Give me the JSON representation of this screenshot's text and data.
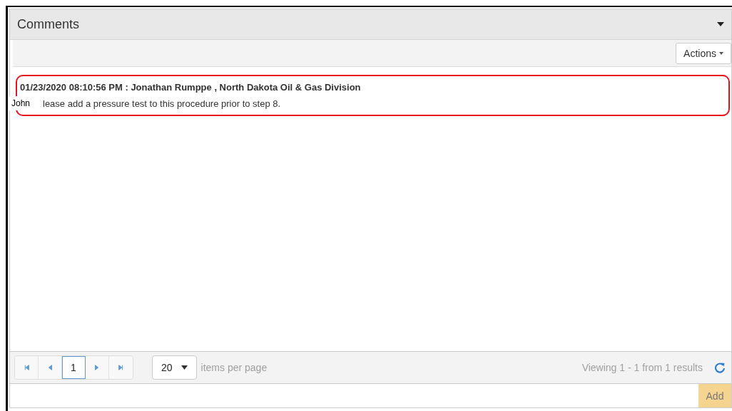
{
  "panel": {
    "title": "Comments",
    "expanded": true
  },
  "toolbar": {
    "actions_button": "Actions"
  },
  "comments": [
    {
      "header": "01/23/2020 08:10:56 PM : Jonathan Rumppe , North Dakota Oil & Gas Division",
      "author_tag": "John",
      "text": "lease add a pressure test to this procedure prior to step 8.",
      "highlighted": true
    }
  ],
  "pager": {
    "pages": [
      {
        "label": "1",
        "selected": true
      }
    ],
    "page_size": "20",
    "page_size_label": "items per page",
    "summary": "Viewing 1 - 1 from 1 results"
  },
  "input": {
    "button": "Add"
  }
}
